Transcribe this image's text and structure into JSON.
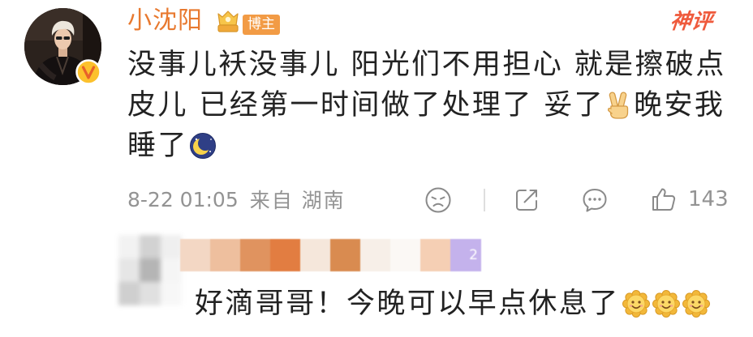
{
  "comment": {
    "username": "小沈阳",
    "badge_label": "博主",
    "featured_label": "神评",
    "text_segments": [
      "没事儿袄没事儿 阳光们不用担心 就是擦破点",
      "皮儿 已经第一时间做了处理了 妥了",
      "晚安我",
      "睡了"
    ],
    "emoji": [
      "victory-hand-emoji",
      "crescent-moon-emoji"
    ],
    "timestamp": "8-22 01:05",
    "source": "来自 湖南",
    "like_count": "143"
  },
  "actions": {
    "icons": [
      "dislike-face-icon",
      "share-icon",
      "comment-icon",
      "like-icon"
    ]
  },
  "reply": {
    "level_badge": "2",
    "text": "好滴哥哥！今晚可以早点休息了",
    "emoji": [
      "smile-emoji",
      "smile-emoji",
      "smile-emoji"
    ]
  },
  "colors": {
    "username": "#e8792f",
    "badge_bg": "#f29b45",
    "featured": "#ef5a3c",
    "meta_text": "#939393",
    "icon_stroke": "#8a8a8a",
    "level_badge_bg": "#c4b2ec",
    "body_text": "#222222"
  }
}
